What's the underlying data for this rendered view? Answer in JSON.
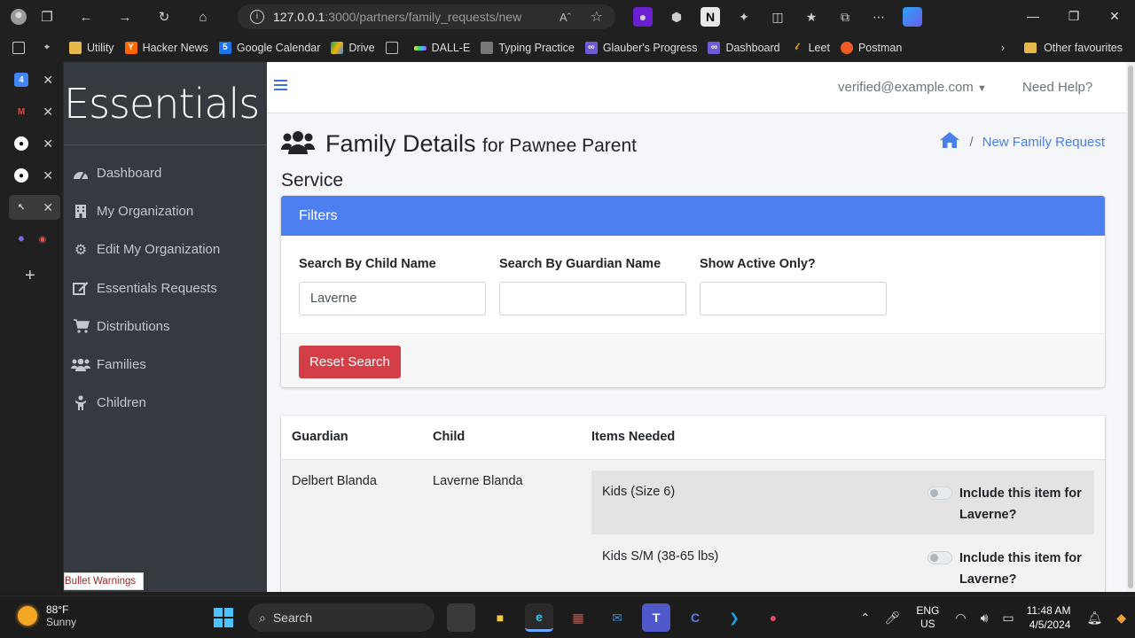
{
  "browser": {
    "url_host": "127.0.0.1",
    "url_rest": ":3000/partners/family_requests/new",
    "read_aloud_label": "Aˆ"
  },
  "bookmarks": [
    {
      "label": "Utility",
      "icon": "folder-icon",
      "color": "#e8b84a"
    },
    {
      "label": "Hacker News",
      "icon": "hacker-news-icon",
      "color": "#ff6600"
    },
    {
      "label": "Google Calendar",
      "icon": "calendar-icon",
      "color": "#1a73e8"
    },
    {
      "label": "Drive",
      "icon": "drive-icon",
      "color": "#0f9d58"
    },
    {
      "label": "",
      "icon": "page-icon",
      "color": "#bbbbbb"
    },
    {
      "label": "DALL-E",
      "icon": "dalle-icon",
      "color": "#666666"
    },
    {
      "label": "Typing Practice",
      "icon": "keyboard-icon",
      "color": "#888888"
    },
    {
      "label": "Glauber's Progress",
      "icon": "meta-icon",
      "color": "#6f5bd6"
    },
    {
      "label": "Dashboard",
      "icon": "meta-icon",
      "color": "#6f5bd6"
    },
    {
      "label": "Leet",
      "icon": "leetcode-icon",
      "color": "#f89f1b"
    },
    {
      "label": "Postman",
      "icon": "postman-icon",
      "color": "#ef5b25"
    }
  ],
  "bookmarks_other": "Other favourites",
  "app": {
    "brand": "Essentials",
    "nav": [
      {
        "label": "Dashboard",
        "icon": "dashboard-icon"
      },
      {
        "label": "My Organization",
        "icon": "building-icon"
      },
      {
        "label": "Edit My Organization",
        "icon": "gear-icon"
      },
      {
        "label": "Essentials Requests",
        "icon": "edit-icon"
      },
      {
        "label": "Distributions",
        "icon": "cart-icon"
      },
      {
        "label": "Families",
        "icon": "users-icon"
      },
      {
        "label": "Children",
        "icon": "child-icon"
      }
    ],
    "bullet_warnings": "Bullet Warnings",
    "user_email": "verified@example.com",
    "need_help": "Need Help?",
    "page_title": "Family Details",
    "page_subtitle": "for Pawnee Parent Service",
    "breadcrumb_current": "New Family Request",
    "filters": {
      "header": "Filters",
      "child_label": "Search By Child Name",
      "child_value": "Laverne",
      "guardian_label": "Search By Guardian Name",
      "guardian_value": "",
      "active_label": "Show Active Only?",
      "active_value": "",
      "reset_label": "Reset Search"
    },
    "table": {
      "headers": [
        "Guardian",
        "Child",
        "Items Needed"
      ],
      "rows": [
        {
          "guardian": "Delbert Blanda",
          "child": "Laverne Blanda",
          "items": [
            {
              "name": "Kids (Size 6)",
              "include_label": "Include this item for Laverne?"
            },
            {
              "name": "Kids S/M (38-65 lbs)",
              "include_label": "Include this item for Laverne?"
            }
          ]
        }
      ]
    }
  },
  "taskbar": {
    "temp": "88°F",
    "condition": "Sunny",
    "search_label": "Search",
    "lang_1": "ENG",
    "lang_2": "US",
    "time": "11:48 AM",
    "date": "4/5/2024"
  },
  "colors": {
    "accent": "#4e7ff0",
    "danger": "#d43f47",
    "sidebar": "#343a40"
  }
}
